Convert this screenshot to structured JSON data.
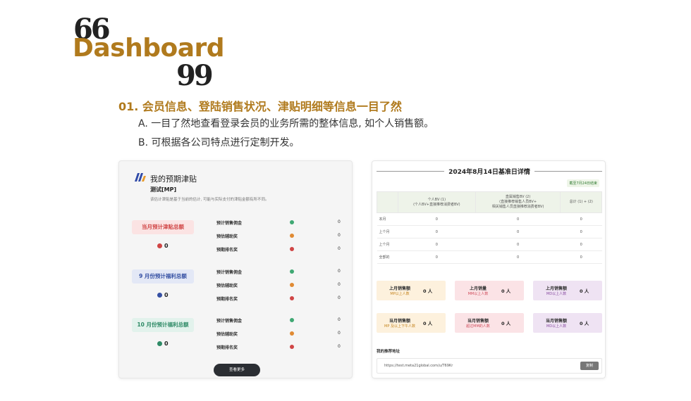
{
  "slide": {
    "quote_open": "66",
    "quote_close": "99",
    "title": "Dashboard",
    "heading": "01. 会员信息、登陆销售状况、津贴明细等信息一目了然",
    "points": [
      "A. 一目了然地查看登录会员的业务所需的整体信息, 如个人销售额。",
      "B. 可根据各公司特点进行定制开发。"
    ],
    "accent_color": "#b07a1d"
  },
  "left_panel": {
    "title": "我的预期津贴",
    "subtitle": "测试[MP]",
    "description": "该估计津贴是基于当前的估计, 可能与实际支付的津贴金额有所不同。",
    "sections": [
      {
        "badge": "当月预计津贴总额",
        "value": "0",
        "rows": [
          {
            "label": "预计销售佣金",
            "value": "0"
          },
          {
            "label": "预估辅助奖",
            "value": "0"
          },
          {
            "label": "预期排名奖",
            "value": "0"
          }
        ]
      },
      {
        "badge": "9 月份预计福利总额",
        "value": "0",
        "rows": [
          {
            "label": "预计销售佣金",
            "value": "0"
          },
          {
            "label": "预估辅助奖",
            "value": "0"
          },
          {
            "label": "预期排名奖",
            "value": "0"
          }
        ]
      },
      {
        "badge": "10 月份预计福利总额",
        "value": "0",
        "rows": [
          {
            "label": "预计销售佣金",
            "value": "0"
          },
          {
            "label": "预估辅助奖",
            "value": "0"
          },
          {
            "label": "预期排名奖",
            "value": "0"
          }
        ]
      }
    ],
    "more_button": "查看更多"
  },
  "right_panel": {
    "title": "2024年8月14日基准日详情",
    "tag": "截至7月24日结束",
    "table": {
      "headers": [
        "",
        "个人BV (1)\n(个人BV+直接推荐消费者BV)",
        "直属销售BV (2)\n(直接推荐销售人员BV+\n相关销售人员直接推荐消费者BV)",
        "总计 (1) + (2)"
      ],
      "rows": [
        [
          "本月",
          "0",
          "0",
          "0"
        ],
        [
          "上个月",
          "0",
          "0",
          "0"
        ],
        [
          "上个月",
          "0",
          "0",
          "0"
        ],
        [
          "全部的",
          "0",
          "0",
          "0"
        ]
      ]
    },
    "cards": [
      {
        "title": "上月销售额",
        "sub": "MP以上人数",
        "value": "0 人"
      },
      {
        "title": "上月销量",
        "sub": "MM以上人数",
        "value": "0 人"
      },
      {
        "title": "上月销售额",
        "sub": "MD以上人数",
        "value": "0 人"
      },
      {
        "title": "当月销售额",
        "sub": "MP 及以上下午人数",
        "value": "0 人"
      },
      {
        "title": "当月销售额",
        "sub": "超过MM的人数",
        "value": "0 人"
      },
      {
        "title": "当月销售额",
        "sub": "MD以上人数",
        "value": "0 人"
      }
    ],
    "referral_label": "我的推荐地址",
    "referral_url": "https://test.meta21global.com/u/T69Kr",
    "copy_button": "复制"
  }
}
